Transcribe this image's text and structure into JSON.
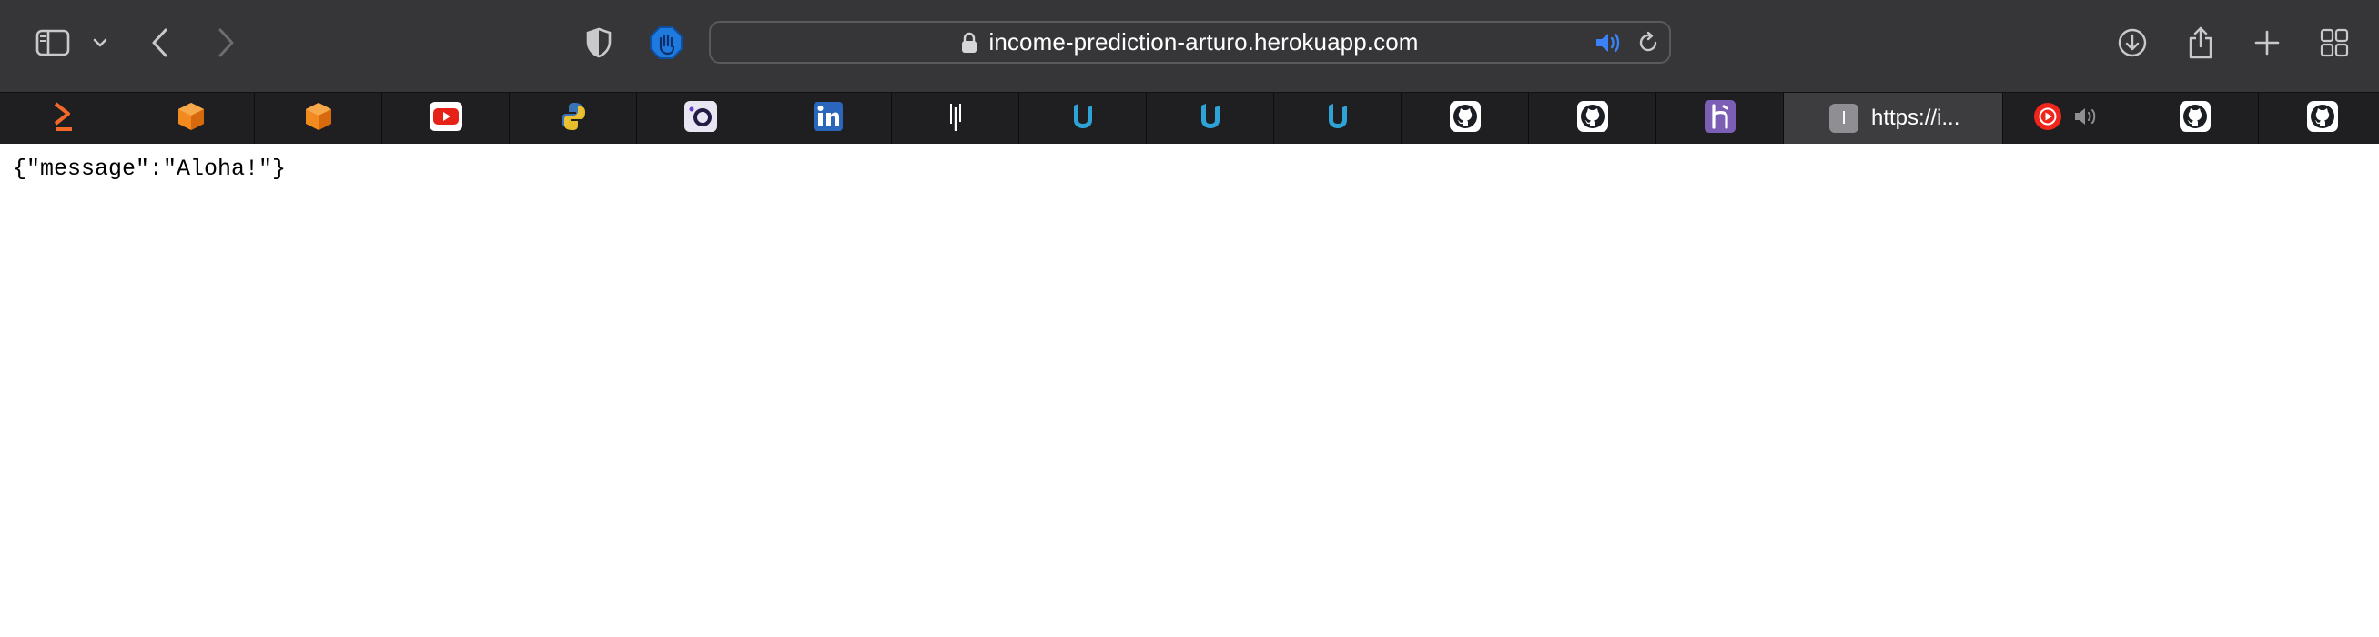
{
  "toolbar": {
    "sidebar_icon": "sidebar-icon",
    "back_icon": "chevron-left-icon",
    "forward_icon": "chevron-right-icon",
    "privacy_icon": "shield-icon",
    "extension_icon": "stop-hand-icon",
    "download_icon": "download-icon",
    "share_icon": "share-icon",
    "newtab_icon": "plus-icon",
    "tabs_overview_icon": "grid-icon"
  },
  "address_bar": {
    "url": "income-prediction-arturo.herokuapp.com",
    "lock_icon": "lock-icon",
    "audio_icon": "speaker-icon",
    "reload_icon": "reload-icon"
  },
  "tabs": [
    {
      "icon": "bolt-chevron-icon"
    },
    {
      "icon": "orange-box-icon"
    },
    {
      "icon": "orange-box-icon"
    },
    {
      "icon": "youtube-icon"
    },
    {
      "icon": "python-icon"
    },
    {
      "icon": "camera-icon"
    },
    {
      "icon": "linkedin-icon"
    },
    {
      "icon": "cursor-icon"
    },
    {
      "icon": "udacity-icon"
    },
    {
      "icon": "udacity-icon"
    },
    {
      "icon": "udacity-icon"
    },
    {
      "icon": "github-icon"
    },
    {
      "icon": "github-icon"
    },
    {
      "icon": "heroku-icon"
    },
    {
      "icon": "letter-i-icon",
      "letter": "I",
      "title": "https://i...",
      "active": true
    },
    {
      "icon": "youtube-music-icon",
      "audio_icon": "speaker-muted-icon"
    },
    {
      "icon": "github-icon"
    },
    {
      "icon": "github-icon"
    }
  ],
  "page": {
    "body_text": "{\"message\":\"Aloha!\"}"
  },
  "colors": {
    "toolbar_bg": "#363638",
    "tabbar_bg": "#1f1f21",
    "active_tab_bg": "#3d3d40",
    "accent_blue": "#3b82f6"
  }
}
